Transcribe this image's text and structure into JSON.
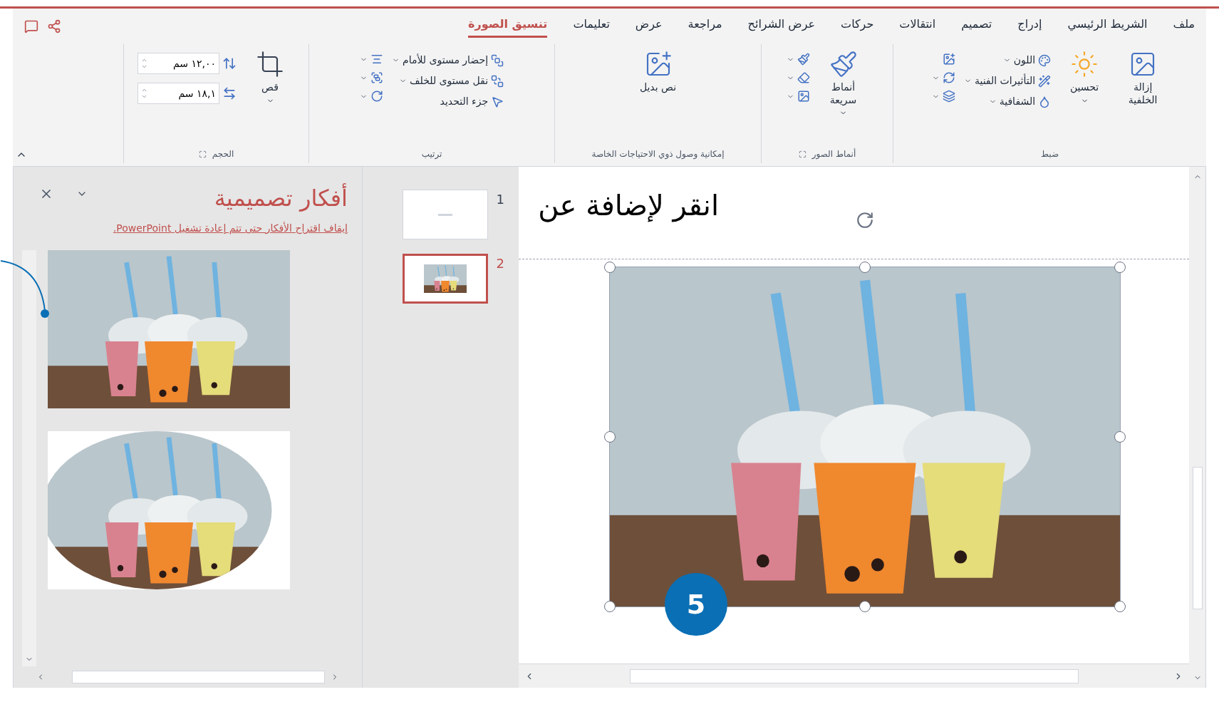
{
  "tabs": [
    {
      "label": "ملف",
      "selected": false
    },
    {
      "label": "الشريط الرئيسي",
      "selected": false
    },
    {
      "label": "إدراج",
      "selected": false
    },
    {
      "label": "تصميم",
      "selected": false
    },
    {
      "label": "انتقالات",
      "selected": false
    },
    {
      "label": "حركات",
      "selected": false
    },
    {
      "label": "عرض الشرائح",
      "selected": false
    },
    {
      "label": "مراجعة",
      "selected": false
    },
    {
      "label": "عرض",
      "selected": false
    },
    {
      "label": "تعليمات",
      "selected": false
    },
    {
      "label": "تنسيق الصورة",
      "selected": true
    }
  ],
  "ribbon": {
    "adjust": {
      "label": "ضبط",
      "remove_background": "إزالة الخلفية",
      "corrections": "تحسين",
      "color_label": "اللون",
      "artistic_effects": "التأثيرات الفنية",
      "transparency": "الشفافية"
    },
    "picture_styles": {
      "label": "أنماط الصور",
      "quick_styles": "أنماط سريعة"
    },
    "accessibility": {
      "label": "إمكانية وصول ذوي الاحتياجات الخاصة",
      "alt_text": "نص بديل"
    },
    "arrange": {
      "label": "ترتيب",
      "bring_forward": "إحضار مستوى للأمام",
      "send_backward": "نقل مستوى للخلف",
      "selection_pane": "جزء التحديد"
    },
    "size": {
      "label": "الحجم",
      "crop": "قص",
      "height": "١٢,٠٠ سم",
      "width": "١٨,١ سم"
    }
  },
  "design_pane": {
    "title": "أفكار تصميمية",
    "message": "إيقاف اقتراح الأفكار حتى تتم إعادة تشغيل PowerPoint."
  },
  "thumbnails": [
    {
      "number": "1",
      "selected": false
    },
    {
      "number": "2",
      "selected": true
    }
  ],
  "slide": {
    "title_placeholder": "انقر لإضافة عن"
  },
  "callout": {
    "number": "5"
  }
}
